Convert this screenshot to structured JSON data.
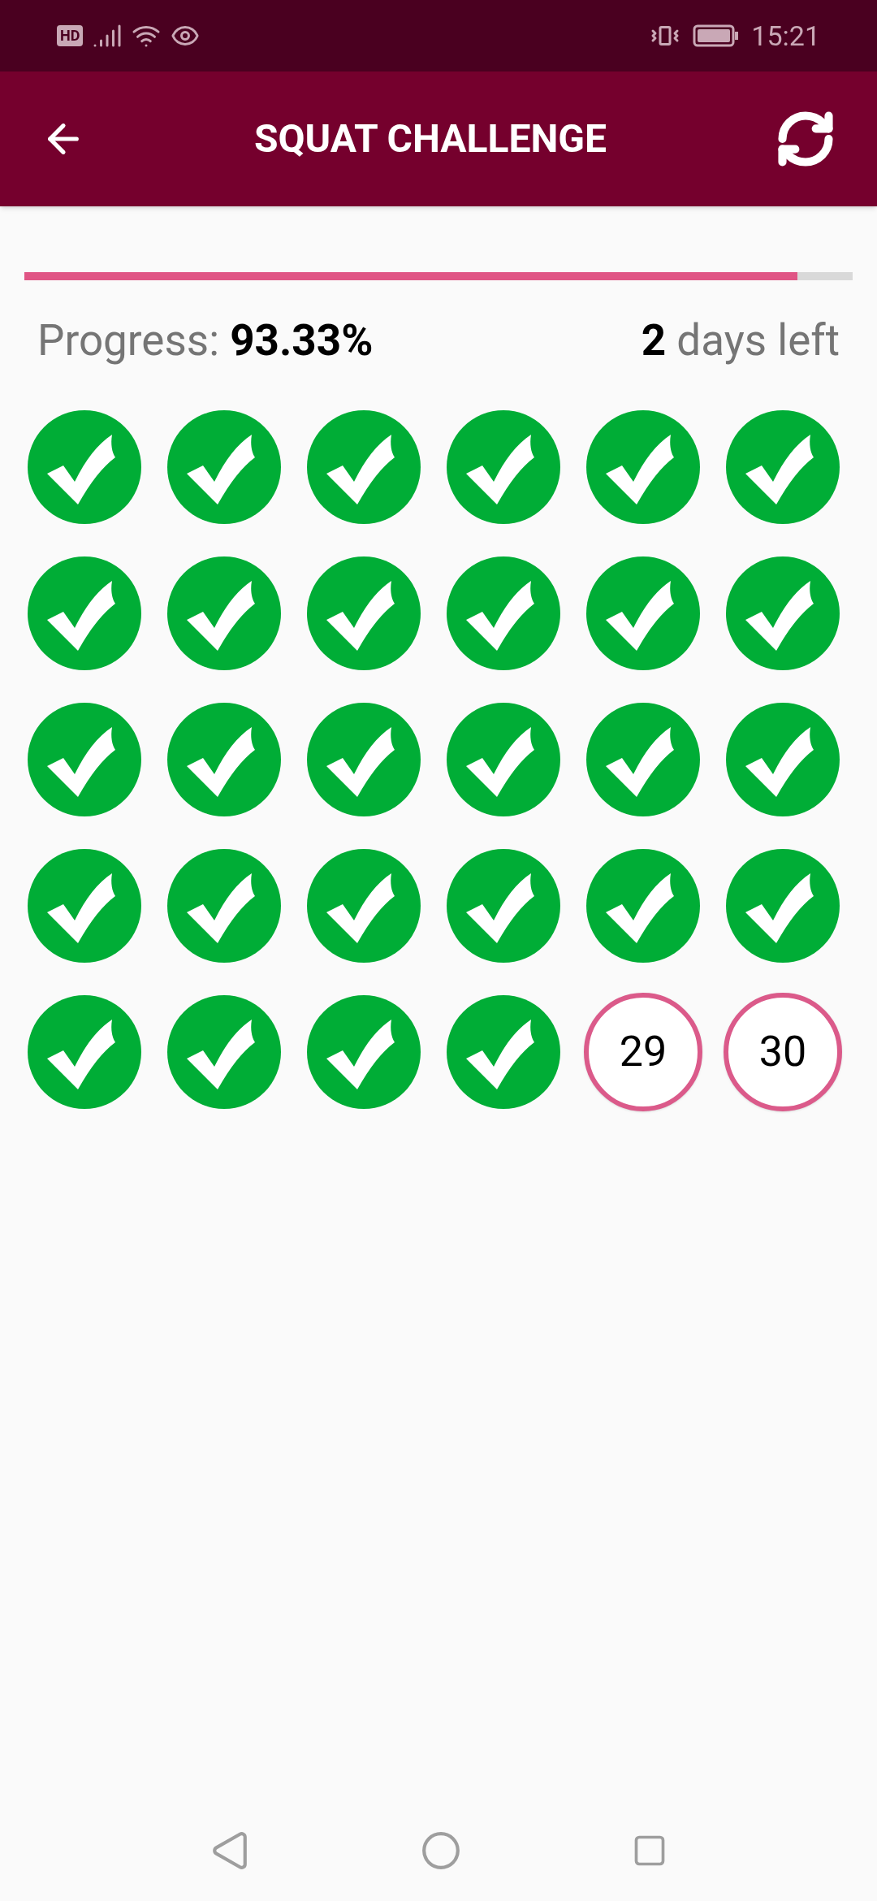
{
  "status_bar": {
    "badge": "HD",
    "time": "15:21"
  },
  "app_bar": {
    "title": "SQUAT CHALLENGE"
  },
  "progress": {
    "level": 0.9333,
    "text": "Progress: **93.33%**",
    "days_left": "**2** days left"
  },
  "days": [
    {
      "done": true
    },
    {
      "done": true
    },
    {
      "done": true
    },
    {
      "done": true
    },
    {
      "done": true
    },
    {
      "done": true
    },
    {
      "done": true
    },
    {
      "done": true
    },
    {
      "done": true
    },
    {
      "done": true
    },
    {
      "done": true
    },
    {
      "done": true
    },
    {
      "done": true
    },
    {
      "done": true
    },
    {
      "done": true
    },
    {
      "done": true
    },
    {
      "done": true
    },
    {
      "done": true
    },
    {
      "done": true
    },
    {
      "done": true
    },
    {
      "done": true
    },
    {
      "done": true
    },
    {
      "done": true
    },
    {
      "done": true
    },
    {
      "done": true
    },
    {
      "done": true
    },
    {
      "done": true
    },
    {
      "done": true
    },
    {
      "done": false,
      "label": "29"
    },
    {
      "done": false,
      "label": "30"
    }
  ]
}
